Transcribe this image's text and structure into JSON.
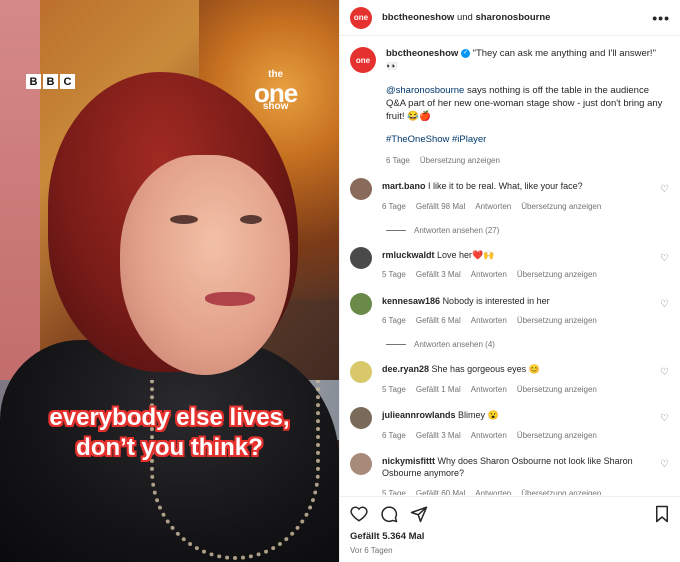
{
  "media": {
    "broadcaster_logo": [
      "B",
      "B",
      "C"
    ],
    "show_logo": {
      "line1": "the",
      "line2": "one",
      "line3": "show"
    },
    "caption_line1": "everybody else lives,",
    "caption_line2": "don’t you think?"
  },
  "header": {
    "account": "bbctheoneshow",
    "connector": "und",
    "collaborator": "sharonosbourne",
    "more_icon": "more-horizontal-icon",
    "avatar_text": "one"
  },
  "post": {
    "author": "bbctheoneshow",
    "quote": "\"They can ask me anything and I'll answer!\" 👀",
    "mention": "@sharonosbourne",
    "body": " says nothing is off the table in the audience Q&A part of her new one-woman stage show - just don't bring any fruit! 😂🍎",
    "hashtags": "#TheOneShow #iPlayer",
    "age": "6 Tage",
    "translate": "Übersetzung anzeigen"
  },
  "comments": [
    {
      "user": "mart.bano",
      "text": "I like it to be real. What, like your face?",
      "age": "6 Tage",
      "likes": "Gefällt 98 Mal",
      "reply": "Antworten",
      "translate": "Übersetzung anzeigen",
      "replies": "Antworten ansehen (27)",
      "avatar_color": "#8a6a5a"
    },
    {
      "user": "rmluckwaldt",
      "text": "Love her❤️🙌",
      "age": "5 Tage",
      "likes": "Gefällt 3 Mal",
      "reply": "Antworten",
      "translate": "Übersetzung anzeigen",
      "replies": "",
      "avatar_color": "#4a4a4a"
    },
    {
      "user": "kennesaw186",
      "text": "Nobody is interested in her",
      "age": "6 Tage",
      "likes": "Gefällt 6 Mal",
      "reply": "Antworten",
      "translate": "Übersetzung anzeigen",
      "replies": "Antworten ansehen (4)",
      "avatar_color": "#6a8a4a"
    },
    {
      "user": "dee.ryan28",
      "text": "She has gorgeous eyes 😊",
      "age": "5 Tage",
      "likes": "Gefällt 1 Mal",
      "reply": "Antworten",
      "translate": "Übersetzung anzeigen",
      "replies": "",
      "avatar_color": "#d8c86a"
    },
    {
      "user": "julieannrowlands",
      "text": "Blimey 😮",
      "age": "6 Tage",
      "likes": "Gefällt 3 Mal",
      "reply": "Antworten",
      "translate": "Übersetzung anzeigen",
      "replies": "",
      "avatar_color": "#7a6a5a"
    },
    {
      "user": "nickymisfittt",
      "text": "Why does Sharon Osbourne not look like Sharon Osbourne anymore?",
      "age": "5 Tage",
      "likes": "Gefällt 60 Mal",
      "reply": "Antworten",
      "translate": "Übersetzung anzeigen",
      "replies": "",
      "avatar_color": "#a88a7a"
    }
  ],
  "footer": {
    "likes": "Gefällt 5.364 Mal",
    "date": "Vor 6 Tagen",
    "icons": [
      "heart-icon",
      "comment-icon",
      "share-icon",
      "bookmark-icon"
    ]
  },
  "colors": {
    "accent_red": "#e5322e",
    "link_blue": "#00376b",
    "verified_blue": "#0095f6",
    "muted": "#737373"
  }
}
